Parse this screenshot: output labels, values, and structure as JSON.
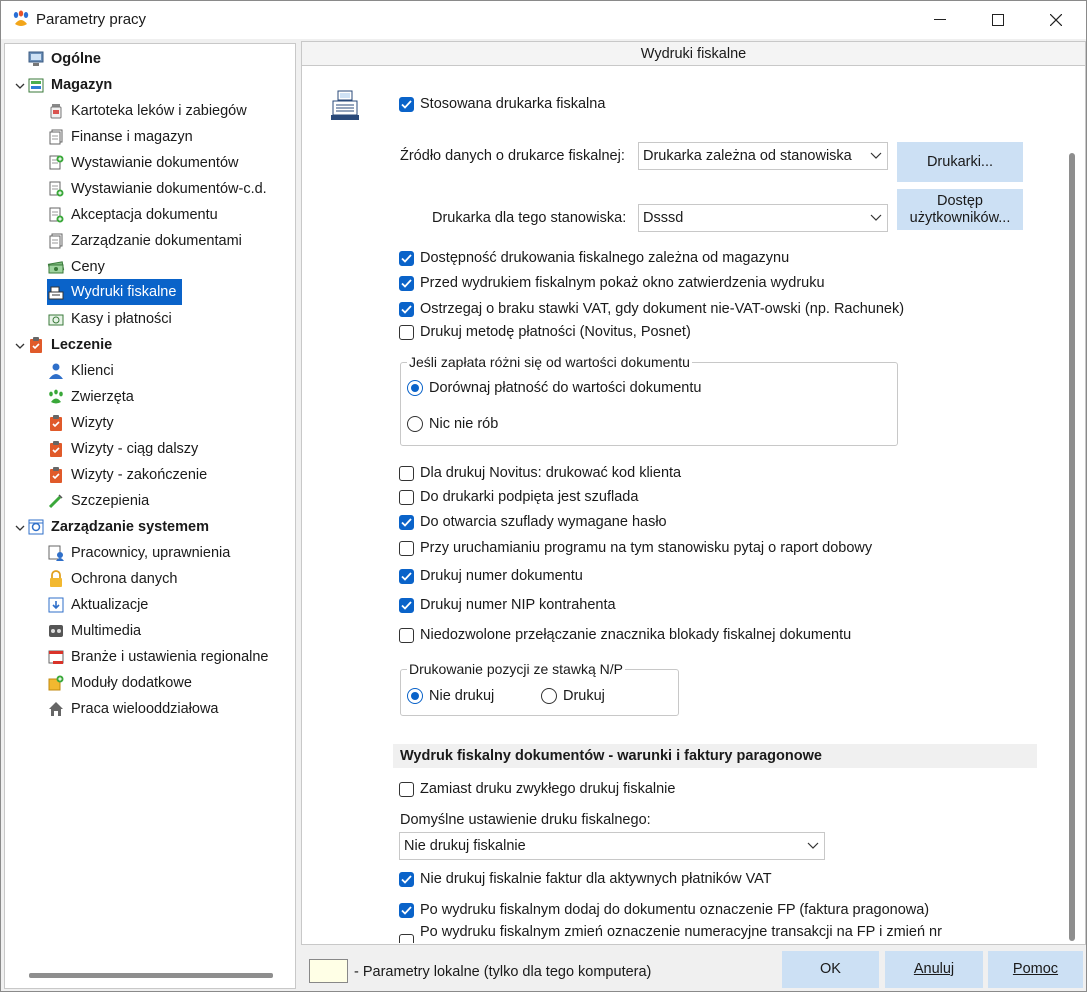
{
  "window": {
    "title": "Parametry pracy"
  },
  "tree": {
    "groups": [
      {
        "label": "Ogólne"
      },
      {
        "label": "Magazyn"
      },
      {
        "label": "Leczenie"
      },
      {
        "label": "Zarządzanie systemem"
      }
    ],
    "magazyn_items": [
      "Kartoteka leków i zabiegów",
      "Finanse i magazyn",
      "Wystawianie dokumentów",
      "Wystawianie dokumentów-c.d.",
      "Akceptacja dokumentu",
      "Zarządzanie dokumentami",
      "Ceny",
      "Wydruki fiskalne",
      "Kasy i płatności"
    ],
    "leczenie_items": [
      "Klienci",
      "Zwierzęta",
      "Wizyty",
      "Wizyty - ciąg dalszy",
      "Wizyty - zakończenie",
      "Szczepienia"
    ],
    "system_items": [
      "Pracownicy, uprawnienia",
      "Ochrona danych",
      "Aktualizacje",
      "Multimedia",
      "Branże i ustawienia regionalne",
      "Moduły dodatkowe",
      "Praca wielooddziałowa"
    ]
  },
  "panel": {
    "header": "Wydruki fiskalne",
    "use_fiscal_printer": "Stosowana drukarka fiskalna",
    "source_label": "Źródło danych o drukarce fiskalnej:",
    "source_value": "Drukarka zależna od stanowiska",
    "printers_button": "Drukarki...",
    "station_printer_label": "Drukarka dla tego stanowiska:",
    "station_printer_value": "Dsssd",
    "user_access_button_line1": "Dostęp",
    "user_access_button_line2": "użytkowników...",
    "options1": [
      {
        "label": "Dostępność drukowania fiskalnego zależna od magazynu",
        "checked": true
      },
      {
        "label": "Przed wydrukiem fiskalnym pokaż okno zatwierdzenia wydruku",
        "checked": true
      },
      {
        "label": "Ostrzegaj o braku stawki VAT, gdy dokument nie-VAT-owski (np. Rachunek)",
        "checked": true
      },
      {
        "label": "Drukuj metodę płatności (Novitus, Posnet)",
        "checked": false
      }
    ],
    "payment_group": {
      "title": "Jeśli zapłata różni się od wartości dokumentu",
      "options": [
        {
          "label": "Dorównaj płatność do wartości dokumentu",
          "selected": true
        },
        {
          "label": "Nic nie rób",
          "selected": false
        }
      ]
    },
    "options2": [
      {
        "label": "Dla drukuj Novitus: drukować kod klienta",
        "checked": false
      },
      {
        "label": "Do drukarki podpięta jest szuflada",
        "checked": false
      },
      {
        "label": "Do otwarcia szuflady wymagane hasło",
        "checked": true
      },
      {
        "label": "Przy uruchamianiu programu na tym stanowisku pytaj o raport dobowy",
        "checked": false
      },
      {
        "label": "Drukuj numer dokumentu",
        "checked": true
      },
      {
        "label": "Drukuj numer NIP kontrahenta",
        "checked": true
      },
      {
        "label": "Niedozwolone przełączanie znacznika blokady fiskalnej dokumentu",
        "checked": false
      }
    ],
    "np_group": {
      "title": "Drukowanie pozycji ze stawką N/P",
      "options": [
        {
          "label": "Nie drukuj",
          "selected": true
        },
        {
          "label": "Drukuj",
          "selected": false
        }
      ]
    },
    "section_title": "Wydruk fiskalny dokumentów - warunki i faktury paragonowe",
    "replace_print": {
      "label": "Zamiast druku zwykłego drukuj fiskalnie",
      "checked": false
    },
    "default_setting_label": "Domyślne ustawienie druku fiskalnego:",
    "default_setting_value": "Nie drukuj fiskalnie",
    "options3": [
      {
        "label": "Nie drukuj fiskalnie faktur dla aktywnych płatników VAT",
        "checked": true
      },
      {
        "label": "Po wydruku fiskalnym dodaj do dokumentu oznaczenie FP (faktura pragonowa)",
        "checked": true
      },
      {
        "label": "Po wydruku fiskalnym zmień oznaczenie numeracyjne transakcji na FP i zmień nr",
        "checked": false
      }
    ]
  },
  "footer": {
    "legend": "- Parametry lokalne (tylko dla tego komputera)",
    "ok": "OK",
    "cancel": "Anuluj",
    "help": "Pomoc"
  },
  "colors": {
    "accent": "#0a63c9",
    "button_bg": "#cce0f4",
    "local_param_bg": "#ffffe6"
  }
}
